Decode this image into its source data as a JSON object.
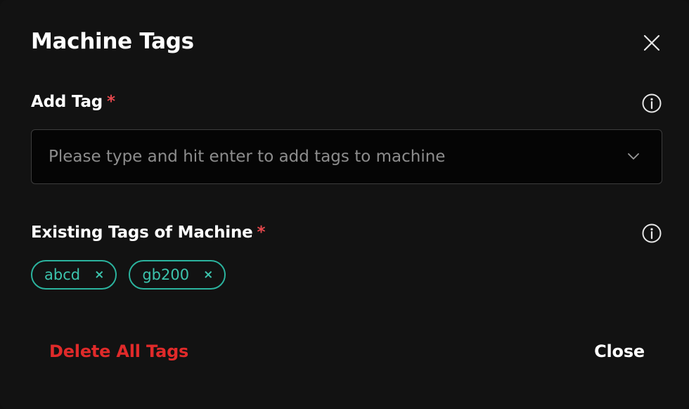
{
  "dialog": {
    "title": "Machine Tags",
    "close_icon": "close-icon"
  },
  "add_tag": {
    "label": "Add Tag",
    "required_marker": "*",
    "info_icon": "info-icon",
    "input_value": "",
    "placeholder": "Please type and hit enter to add tags to machine",
    "dropdown_icon": "chevron-down-icon"
  },
  "existing_tags": {
    "label": "Existing Tags of Machine",
    "required_marker": "*",
    "info_icon": "info-icon",
    "tags": [
      {
        "label": "abcd",
        "remove": "×"
      },
      {
        "label": "gb200",
        "remove": "×"
      }
    ]
  },
  "footer": {
    "delete_all_label": "Delete All Tags",
    "close_label": "Close"
  },
  "colors": {
    "background": "#121212",
    "tag_accent": "#2bb39e",
    "danger": "#e02a2a",
    "required": "#e5484d"
  }
}
